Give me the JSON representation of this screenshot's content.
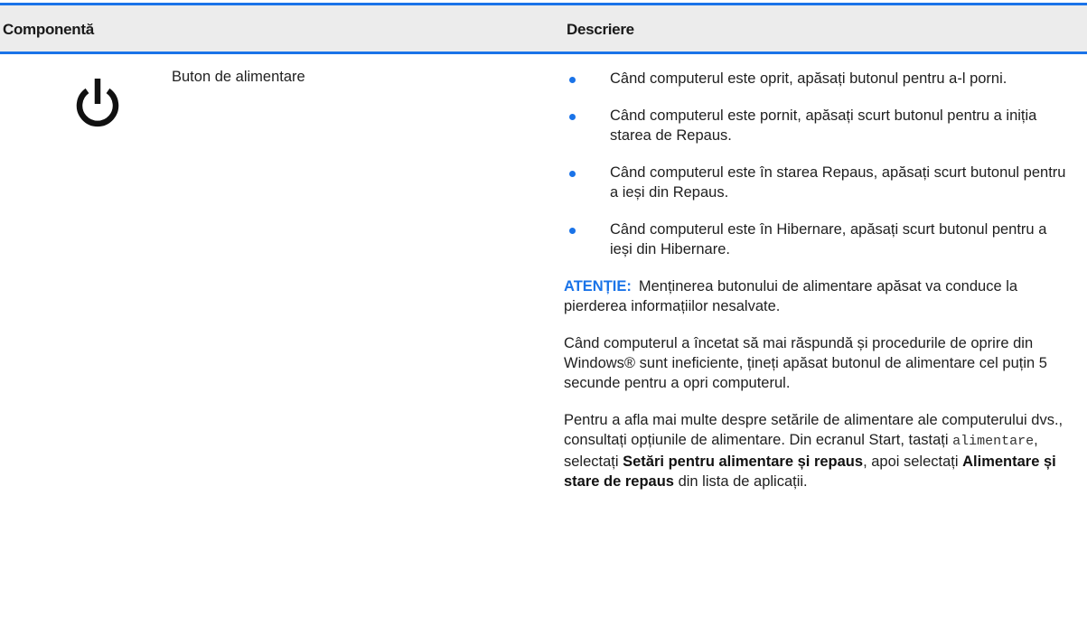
{
  "header": {
    "component_label": "Componentă",
    "description_label": "Descriere"
  },
  "row": {
    "icon": "power-icon",
    "component_name": "Buton de alimentare",
    "bullets": [
      "Când computerul este oprit, apăsați butonul pentru a-l porni.",
      "Când computerul este pornit, apăsați scurt butonul pentru a iniția starea de Repaus.",
      "Când computerul este în starea Repaus, apăsați scurt butonul pentru a ieși din Repaus.",
      "Când computerul este în Hibernare, apăsați scurt butonul pentru a ieși din Hibernare."
    ],
    "caution_label": "ATENȚIE:",
    "caution_text": "Menținerea butonului de alimentare apăsat va conduce la pierderea informațiilor nesalvate.",
    "paragraph2": "Când computerul a încetat să mai răspundă și procedurile de oprire din Windows® sunt ineficiente, țineți apăsat butonul de alimentare cel puțin 5 secunde pentru a opri computerul.",
    "paragraph3": {
      "part1": "Pentru a afla mai multe despre setările de alimentare ale computerului dvs., consultați opțiunile de alimentare. Din ecranul Start, tastați ",
      "code": "alimentare",
      "part2": ", selectați ",
      "bold1": "Setări pentru alimentare și repaus",
      "part3": ", apoi selectați ",
      "bold2": "Alimentare și stare de repaus",
      "part4": " din lista de aplicații."
    }
  },
  "colors": {
    "accent": "#1a73e8",
    "header_bg": "#ececec"
  }
}
